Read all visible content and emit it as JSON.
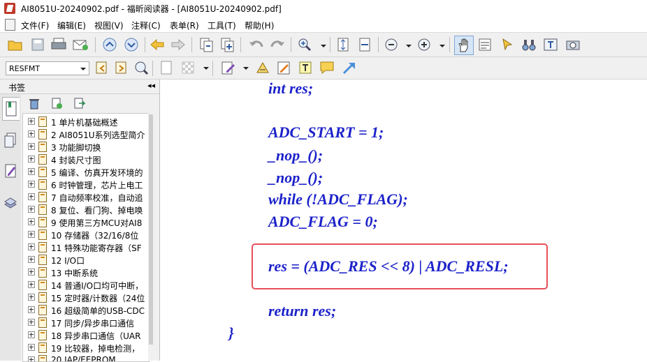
{
  "window": {
    "title": "AI8051U-20240902.pdf - 福昕阅读器 - [AI8051U-20240902.pdf]"
  },
  "menu": [
    "文件(F)",
    "编辑(E)",
    "视图(V)",
    "注释(C)",
    "表单(R)",
    "工具(T)",
    "帮助(H)"
  ],
  "toolbar2": {
    "font_name": "RESFMT"
  },
  "sidebar": {
    "title": "书签",
    "bookmarks": [
      "1 单片机基础概述",
      "2 AI8051U系列选型简介",
      "3 功能脚切换",
      "4 封装尺寸图",
      "5 编译、仿真开发环境的",
      "6 时钟管理，芯片上电工",
      "7 自动频率校准，自动追",
      "8 复位、看门狗、掉电唤",
      "9 使用第三方MCU对AI8",
      "10 存储器（32/16/8位",
      "11 特殊功能寄存器（SF",
      "12 I/O口",
      "13 中断系统",
      "14 普通I/O口均可中断，",
      "15 定时器/计数器（24位",
      "16 超级简单的USB-CDC",
      "17 同步/异步串口通信",
      "18 异步串口通信（UAR",
      "19 比较器，掉电检测，",
      "20 IAP/EEPROM"
    ]
  },
  "document": {
    "code_lines": [
      "int res;",
      "ADC_START = 1;",
      "_nop_();",
      "_nop_();",
      "while (!ADC_FLAG);",
      "ADC_FLAG = 0;",
      "res = (ADC_RES << 8) | ADC_RESL;",
      "return res;",
      "}"
    ]
  },
  "colors": {
    "code_text": "#1c22c9",
    "highlight_border": "#e8505b"
  }
}
